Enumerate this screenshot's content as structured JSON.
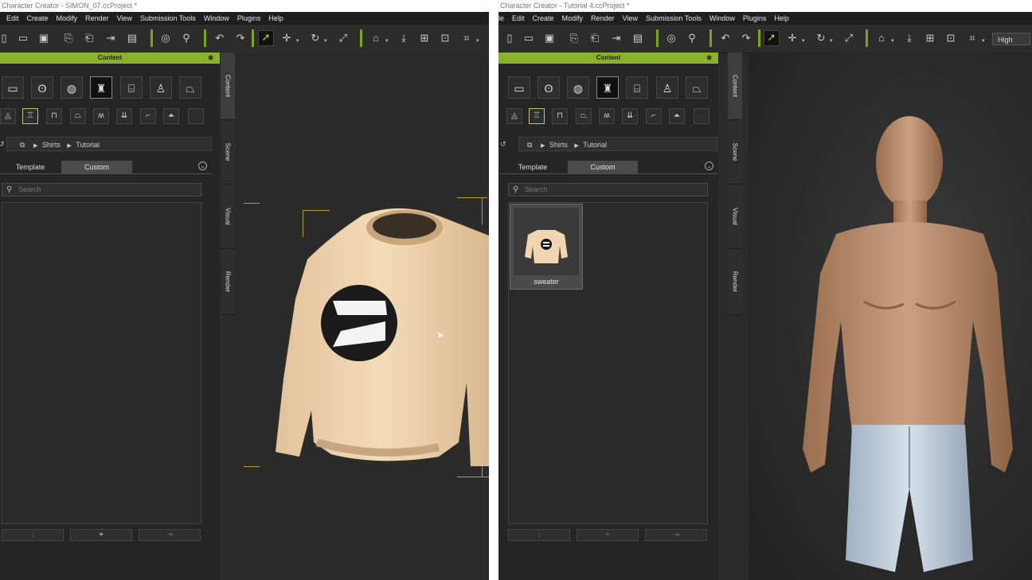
{
  "left_window": {
    "title": "Character Creator - SIMON_07.ccProject *",
    "menu": [
      "Edit",
      "Create",
      "Modify",
      "Render",
      "View",
      "Submission Tools",
      "Window",
      "Plugins",
      "Help"
    ],
    "panel_title": "Content",
    "breadcrumb": [
      "Shirts",
      "Tutorial"
    ],
    "tabs": {
      "template": "Template",
      "custom": "Custom"
    },
    "search_placeholder": "Search",
    "side_tabs": [
      "Content",
      "Scene",
      "Visual",
      "Render"
    ]
  },
  "right_window": {
    "title": "Character Creator - Tutorial 4.ccProject *",
    "menu": [
      "le",
      "Edit",
      "Create",
      "Modify",
      "Render",
      "View",
      "Submission Tools",
      "Window",
      "Plugins",
      "Help"
    ],
    "quality": "High",
    "panel_title": "Content",
    "breadcrumb": [
      "Shirts",
      "Tutorial"
    ],
    "tabs": {
      "template": "Template",
      "custom": "Custom"
    },
    "search_placeholder": "Search",
    "items": [
      {
        "label": "sweater"
      }
    ],
    "side_tabs": [
      "Content",
      "Scene",
      "Visual",
      "Render"
    ]
  },
  "colors": {
    "accent": "#8ab12a",
    "panel": "#262626",
    "sweater": "#f1d5b0",
    "logo_dark": "#1b1b1b"
  },
  "icons": {
    "toolbar": [
      "new-file-icon",
      "open-folder-icon",
      "save-icon",
      "export-icon",
      "import-icon",
      "send-icon",
      "preview-icon",
      "camera-icon",
      "pose-icon",
      "undo-icon",
      "redo-icon",
      "select-arrow-icon",
      "move-icon",
      "rotate-icon",
      "scale-icon",
      "home-icon",
      "down-arrow-icon",
      "fit-icon",
      "frame-icon",
      "camera-view-icon"
    ],
    "content_categories": [
      "folder-icon",
      "body-icon",
      "skin-icon",
      "cloth-icon",
      "accessory-icon",
      "motion-icon",
      "scene-icon"
    ],
    "cloth_sub": [
      "hair-icon",
      "shirt-icon",
      "pants-icon",
      "skirt-icon",
      "gloves-icon",
      "tie-icon",
      "shoe-icon",
      "hanger-icon",
      "blank-icon"
    ]
  }
}
